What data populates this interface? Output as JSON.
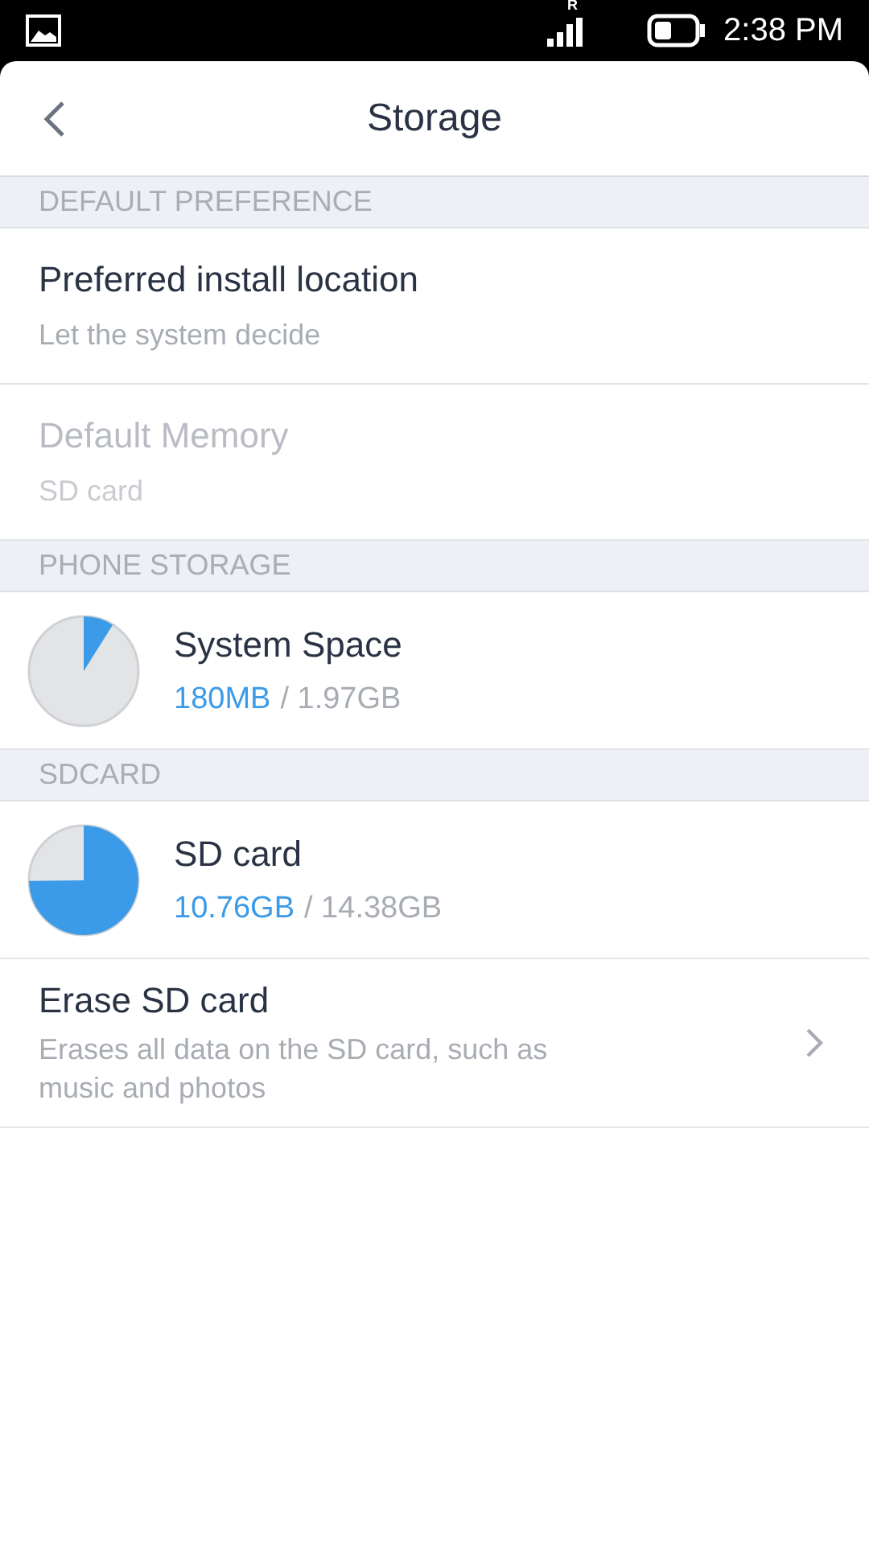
{
  "status_bar": {
    "roaming": "R",
    "time": "2:38 PM"
  },
  "header": {
    "title": "Storage"
  },
  "sections": [
    {
      "title": "DEFAULT PREFERENCE",
      "items": [
        {
          "kind": "setting",
          "title": "Preferred install location",
          "subtitle": "Let the system decide",
          "disabled": false
        },
        {
          "kind": "setting",
          "title": "Default Memory",
          "subtitle": "SD card",
          "disabled": true
        }
      ]
    },
    {
      "title": "PHONE STORAGE",
      "items": [
        {
          "kind": "storage",
          "title": "System Space",
          "used": "180MB",
          "total": "/ 1.97GB"
        }
      ]
    },
    {
      "title": "SDCARD",
      "items": [
        {
          "kind": "storage",
          "title": "SD card",
          "used": "10.76GB",
          "total": "/ 14.38GB"
        },
        {
          "kind": "action",
          "title": "Erase SD card",
          "subtitle": "Erases all data on the SD card, such as music and photos"
        }
      ]
    }
  ]
}
